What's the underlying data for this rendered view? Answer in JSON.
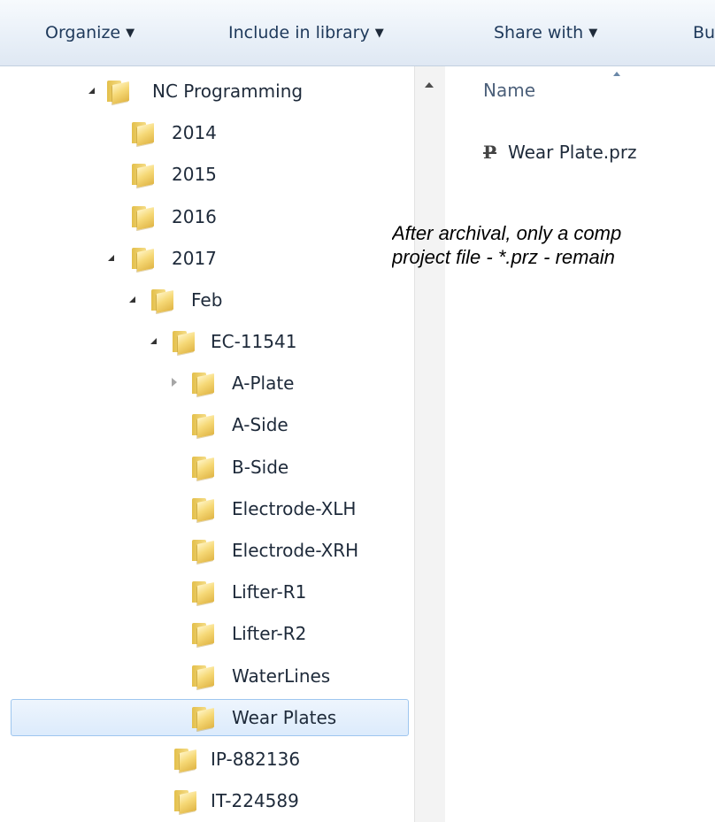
{
  "toolbar": {
    "organize": "Organize",
    "include_in_library": "Include in library",
    "share_with": "Share with",
    "burn": "Bu",
    "dropdown_icon": "caret-down"
  },
  "tree": {
    "items": [
      {
        "label": "NC Programming",
        "state": "expanded"
      },
      {
        "label": "2014",
        "state": "leaf"
      },
      {
        "label": "2015",
        "state": "leaf"
      },
      {
        "label": "2016",
        "state": "leaf"
      },
      {
        "label": "2017",
        "state": "expanded"
      },
      {
        "label": "Feb",
        "state": "expanded"
      },
      {
        "label": "EC-11541",
        "state": "expanded"
      },
      {
        "label": "A-Plate",
        "state": "collapsed"
      },
      {
        "label": "A-Side",
        "state": "leaf"
      },
      {
        "label": "B-Side",
        "state": "leaf"
      },
      {
        "label": "Electrode-XLH",
        "state": "leaf"
      },
      {
        "label": "Electrode-XRH",
        "state": "leaf"
      },
      {
        "label": "Lifter-R1",
        "state": "leaf"
      },
      {
        "label": "Lifter-R2",
        "state": "leaf"
      },
      {
        "label": "WaterLines",
        "state": "leaf"
      },
      {
        "label": "Wear Plates",
        "state": "selected"
      },
      {
        "label": "IP-882136",
        "state": "leaf"
      },
      {
        "label": "IT-224589",
        "state": "leaf"
      }
    ]
  },
  "content": {
    "column_name": "Name",
    "files": [
      {
        "name": "Wear Plate.prz",
        "icon": "prz-file-icon"
      }
    ]
  },
  "caption": {
    "line1": "After archival, only a comp",
    "line2": "project file - *.prz - remain"
  },
  "colors": {
    "toolbar_bg": "#e9f0f8",
    "selection_bg": "#dcebfc",
    "selection_border": "#9ec6ef",
    "folder": "#f6d977"
  }
}
